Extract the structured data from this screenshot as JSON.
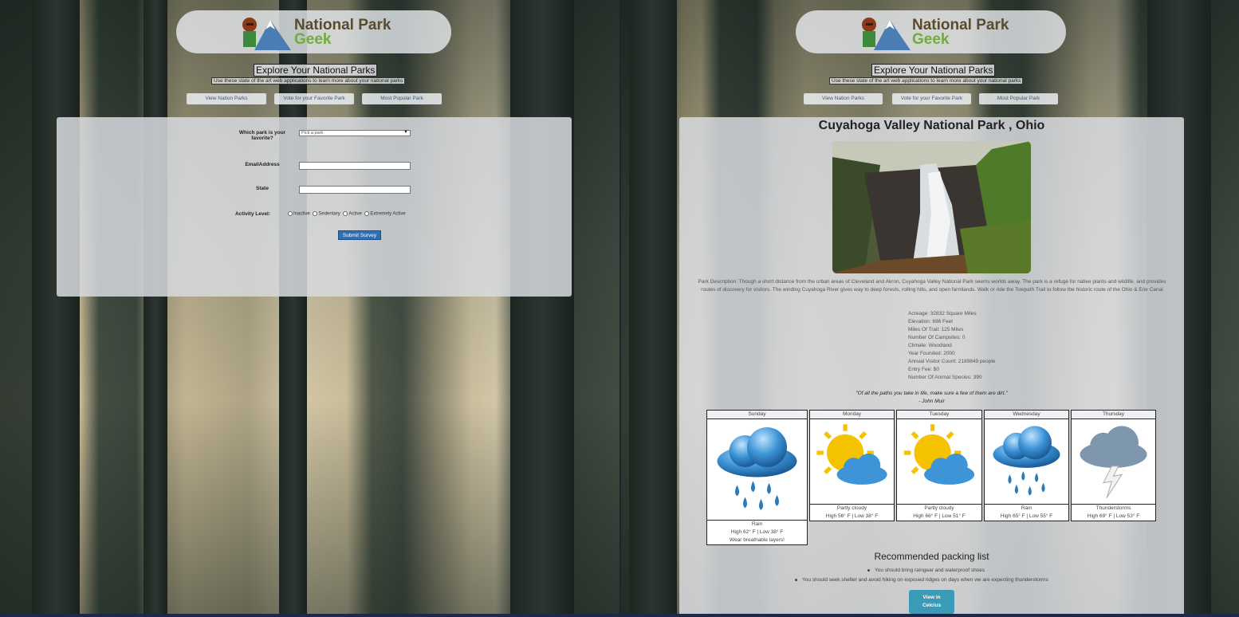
{
  "logo": {
    "line1": "National Park",
    "line2": "Geek"
  },
  "hero": {
    "title": "Explore Your National Parks",
    "subtitle": "Use these state of the art web applications to learn more about your national parks"
  },
  "nav": {
    "view_parks": "View Nation Parks",
    "vote": "Vote for your Favorite Park",
    "popular": "Most Popular Park"
  },
  "survey": {
    "park_label": "Which park is your favorite?",
    "park_select": "Pick a park",
    "email_label": "EmailAddress",
    "state_label": "State",
    "activity_label": "Activity Level:",
    "activity_options": [
      "Inactive",
      "Sedentary",
      "Active",
      "Extremely Active"
    ],
    "submit": "Submit Survey"
  },
  "park": {
    "title": "Cuyahoga Valley National Park , Ohio",
    "description": "Park Description: Though a short distance from the urban areas of Cleveland and Akron, Cuyahoga Valley National Park seems worlds away. The park is a refuge for native plants and wildlife, and provides routes of discovery for visitors. The winding Cuyahoga River gives way to deep forests, rolling hills, and open farmlands. Walk or ride the Towpath Trail to follow the historic route of the Ohio & Erie Canal",
    "stats": [
      "Acreage: 32832 Square Miles",
      "Elevation: 696 Feet",
      "Miles Of Trail: 125 Miles",
      "Number Of Campsites: 0",
      "Climate: Woodland",
      "Year Founded: 2000",
      "Annual Visitor Count: 2189849 people",
      "Entry Fee: $0",
      "Number Of Animal Species: 390"
    ],
    "quote": "\"Of all the paths you take in life, make sure a few of them are dirt.\"",
    "quote_author": "- John Muir"
  },
  "forecast": [
    {
      "day": "Sunday",
      "icon": "rain-icon",
      "condition": "Rain",
      "temps": "High 62° F | Low 38° F",
      "advice": "Wear breathable layers!"
    },
    {
      "day": "Monday",
      "icon": "partly-cloudy-icon",
      "condition": "Partly cloudy",
      "temps": "High 56° F | Low 38° F"
    },
    {
      "day": "Tuesday",
      "icon": "partly-cloudy-icon",
      "condition": "Partly cloudy",
      "temps": "High 66° F | Low 51° F"
    },
    {
      "day": "Wednesday",
      "icon": "rain-icon",
      "condition": "Rain",
      "temps": "High 65° F | Low 55° F"
    },
    {
      "day": "Thursday",
      "icon": "thunderstorm-icon",
      "condition": "Thunderstorms",
      "temps": "High 69° F | Low 53° F"
    }
  ],
  "packing": {
    "title": "Recommended packing list",
    "items": [
      "You should bring raingear and waterproof shoes",
      "You should seek shelter and avoid hiking on exposed ridges on days when we are expecting thunderstorms"
    ],
    "celsius_line1": "View in",
    "celsius_line2": "Celcius"
  },
  "colors": {
    "panel": "#d7dade",
    "accent": "#2f6fb3",
    "celsius_button": "#3a9bb8"
  }
}
